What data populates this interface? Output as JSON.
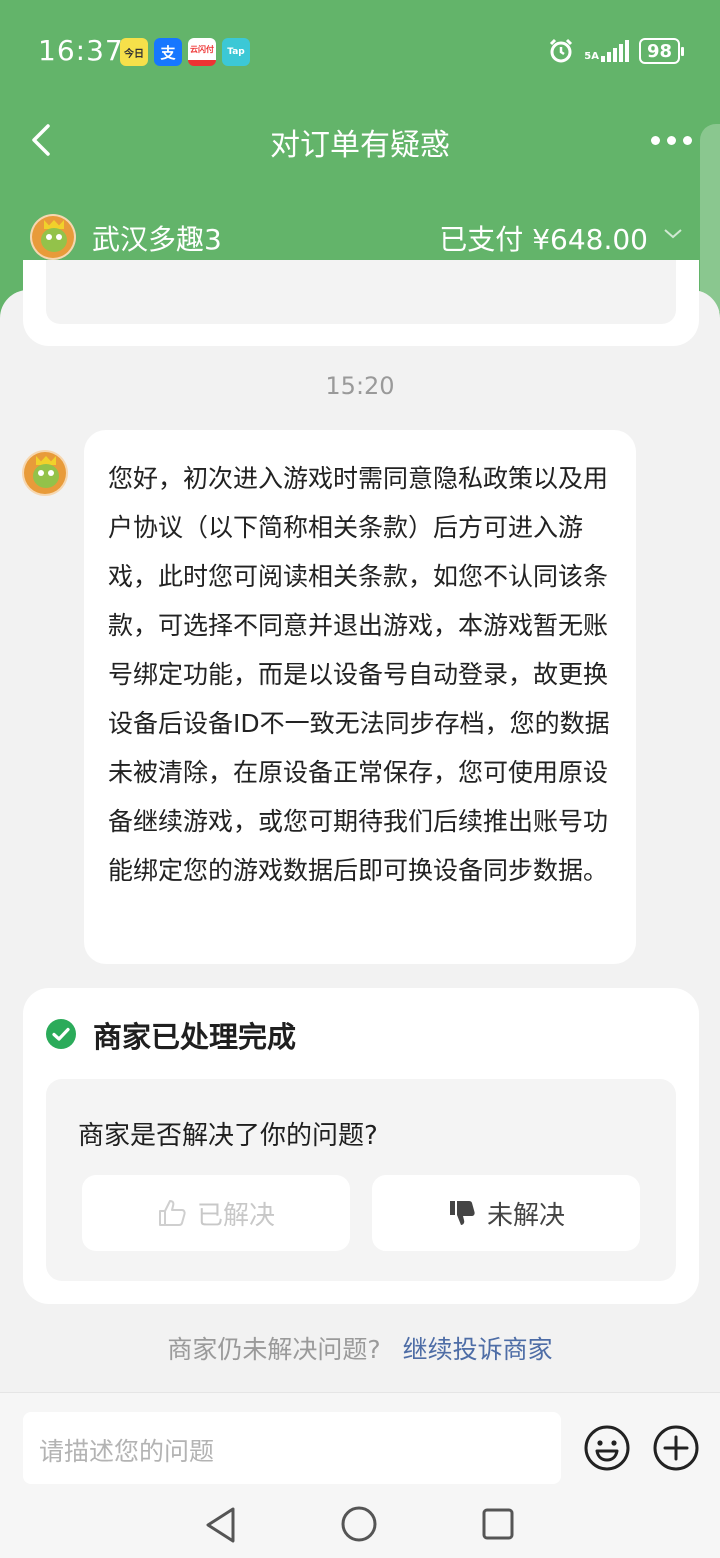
{
  "status_bar": {
    "time": "16:37",
    "app_icons": [
      "今日",
      "支",
      "云闪付",
      "Tap"
    ],
    "signal_label": "5A",
    "battery": "98"
  },
  "nav": {
    "title": "对订单有疑惑"
  },
  "merchant": {
    "name": "武汉多趣3",
    "payment_status": "已支付 ¥648.00"
  },
  "chat": {
    "timestamp": "15:20",
    "message": "您好，初次进入游戏时需同意隐私政策以及用户协议（以下简称相关条款）后方可进入游戏，此时您可阅读相关条款，如您不认同该条款，可选择不同意并退出游戏，本游戏暂无账号绑定功能，而是以设备号自动登录，故更换设备后设备ID不一致无法同步存档，您的数据未被清除，在原设备正常保存，您可使用原设备继续游戏，或您可期待我们后续推出账号功能绑定您的游戏数据后即可换设备同步数据。"
  },
  "status_card": {
    "title": "商家已处理完成",
    "question": "商家是否解决了你的问题?",
    "resolved_label": "已解决",
    "unresolved_label": "未解决"
  },
  "complain": {
    "prompt": "商家仍未解决问题?",
    "link": "继续投诉商家"
  },
  "input": {
    "placeholder": "请描述您的问题"
  },
  "colors": {
    "header_green": "#63b46a",
    "check_green": "#2bab5a",
    "link_blue": "#4e6da6"
  }
}
